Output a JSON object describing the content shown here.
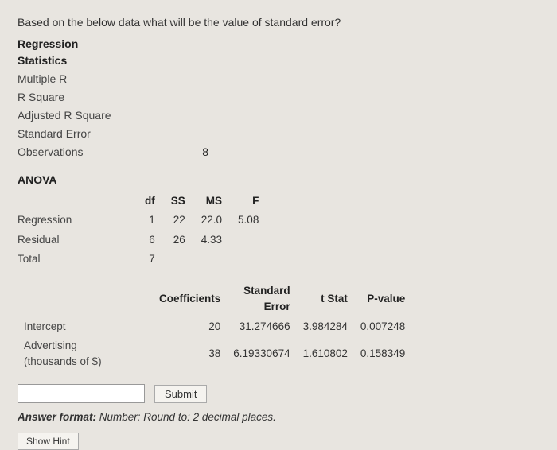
{
  "question": "Based on the below data what will be the value of standard error?",
  "stats": {
    "heading1": "Regression",
    "heading2": "Statistics",
    "rows": [
      {
        "label": "Multiple R",
        "value": ""
      },
      {
        "label": "R Square",
        "value": ""
      },
      {
        "label": "Adjusted R Square",
        "value": ""
      },
      {
        "label": "Standard Error",
        "value": ""
      },
      {
        "label": "Observations",
        "value": "8"
      }
    ]
  },
  "anova": {
    "title": "ANOVA",
    "headers": {
      "df": "df",
      "ss": "SS",
      "ms": "MS",
      "f": "F"
    },
    "rows": [
      {
        "label": "Regression",
        "df": "1",
        "ss": "22",
        "ms": "22.0",
        "f": "5.08"
      },
      {
        "label": "Residual",
        "df": "6",
        "ss": "26",
        "ms": "4.33",
        "f": ""
      },
      {
        "label": "Total",
        "df": "7",
        "ss": "",
        "ms": "",
        "f": ""
      }
    ]
  },
  "coef": {
    "headers": {
      "coef": "Coefficients",
      "se": "Standard Error",
      "se_l1": "Standard",
      "se_l2": "Error",
      "t": "t Stat",
      "p": "P-value"
    },
    "rows": [
      {
        "label": "Intercept",
        "coef": "20",
        "se": "31.274666",
        "t": "3.984284",
        "p": "0.007248"
      },
      {
        "label_l1": "Advertising",
        "label_l2": "(thousands of $)",
        "coef": "38",
        "se": "6.19330674",
        "t": "1.610802",
        "p": "0.158349"
      }
    ]
  },
  "answer": {
    "input_value": "",
    "submit": "Submit",
    "format_label": "Answer format:",
    "format_text": " Number: Round to: 2 decimal places.",
    "hint": "Show Hint"
  }
}
